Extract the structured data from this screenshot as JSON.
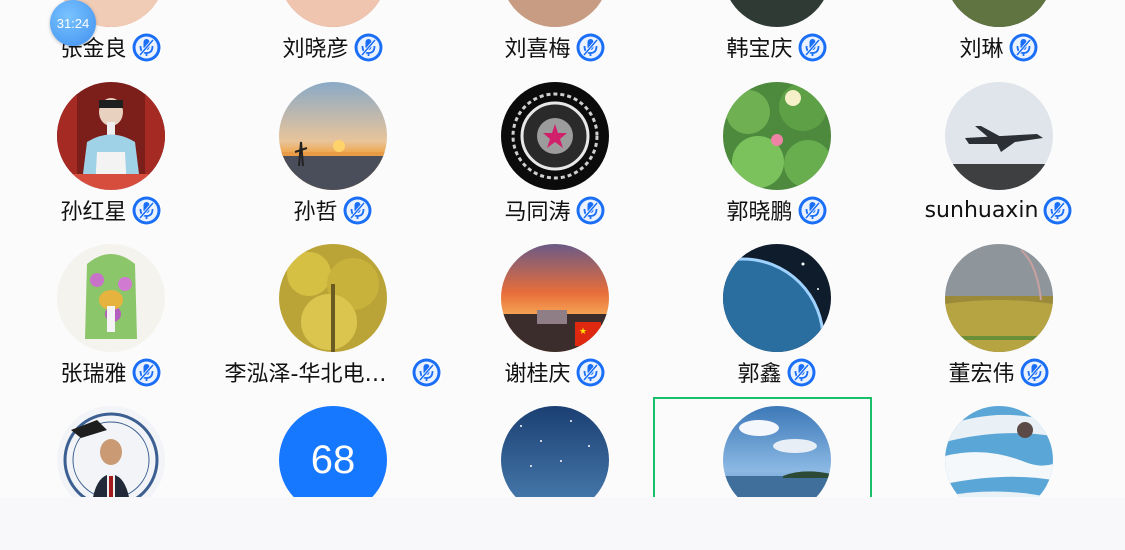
{
  "timer": "31:24",
  "rows": [
    {
      "cells": [
        {
          "name": "张金良",
          "avatar": "partial-top-orange"
        },
        {
          "name": "刘晓彦",
          "avatar": "partial-top-orange"
        },
        {
          "name": "刘喜梅",
          "avatar": "partial-top-beige"
        },
        {
          "name": "韩宝庆",
          "avatar": "partial-top-dark"
        },
        {
          "name": "刘琳",
          "avatar": "partial-top-green"
        }
      ]
    },
    {
      "cells": [
        {
          "name": "孙红星",
          "avatar": "opera-performer"
        },
        {
          "name": "孙哲",
          "avatar": "sunset-water"
        },
        {
          "name": "马同涛",
          "avatar": "star-emblem"
        },
        {
          "name": "郭晓鹏",
          "avatar": "lotus-leaves"
        },
        {
          "name": "sunhuaxin",
          "avatar": "fighter-jet"
        }
      ]
    },
    {
      "cells": [
        {
          "name": "张瑞雅",
          "avatar": "flower-painting"
        },
        {
          "name": "李泓泽-华北电力...",
          "avatar": "ginkgo-tree"
        },
        {
          "name": "谢桂庆",
          "avatar": "sunset-flag"
        },
        {
          "name": "郭鑫",
          "avatar": "earth-space"
        },
        {
          "name": "董宏伟",
          "avatar": "crop-field-rainbow"
        }
      ]
    },
    {
      "cells": [
        {
          "name": "",
          "avatar": "university-portrait"
        },
        {
          "name": "",
          "avatar": "count-badge",
          "count": "68"
        },
        {
          "name": "",
          "avatar": "night-sky"
        },
        {
          "name": "",
          "avatar": "sea-sky"
        },
        {
          "name": "",
          "avatar": "snow-river"
        }
      ]
    }
  ],
  "icons": {
    "mic": "microphone-muted-icon",
    "timer": "timer-badge-icon"
  },
  "colors": {
    "accent": "#1677ff",
    "selection": "#19c06a",
    "background": "#f8f8fa"
  }
}
